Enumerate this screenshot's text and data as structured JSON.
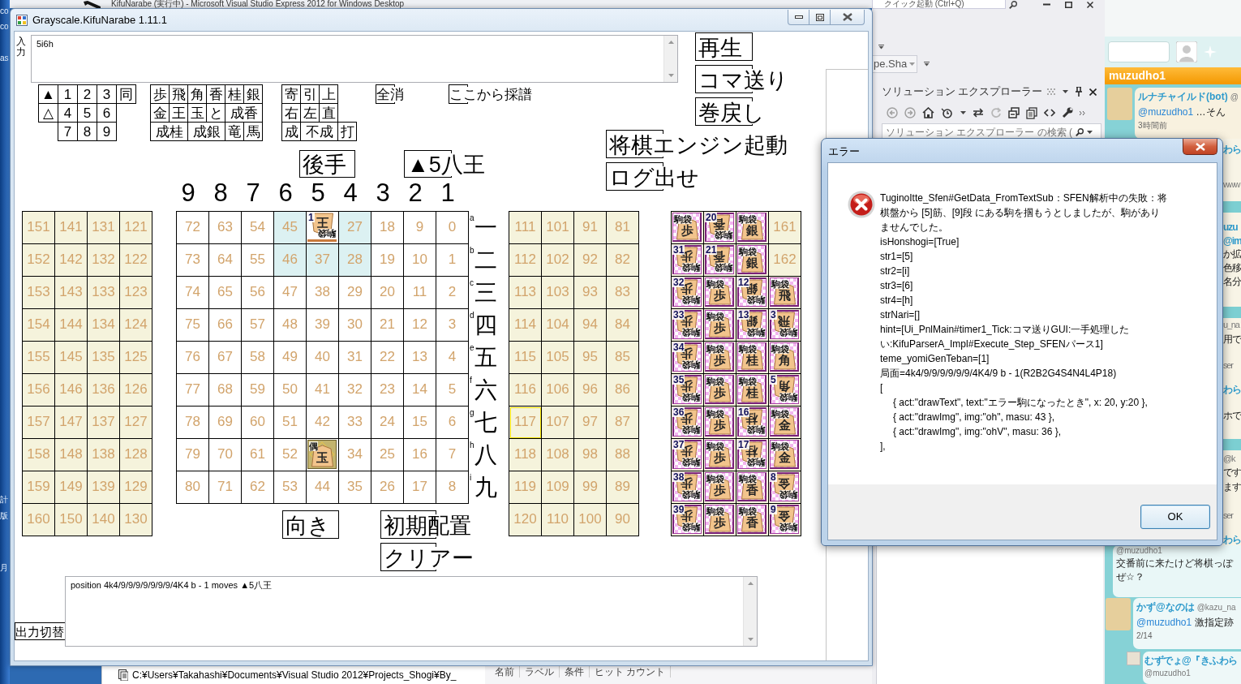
{
  "desktop": {
    "fragments": [
      "co",
      "co",
      "as",
      "計",
      "版",
      "月"
    ]
  },
  "ide": {
    "title": "KifuNarabe (実行中) - Microsoft Visual Studio Express 2012 for Windows Desktop",
    "quick_launch": {
      "placeholder": "クイック起動 (Ctrl+Q)"
    },
    "configuration": "pe.Sha",
    "solution_explorer": {
      "title": "ソリューション エクスプローラー",
      "search": {
        "placeholder": "ソリューション エクスプローラー の検索 ("
      }
    },
    "status_path": "C:¥Users¥Takahashi¥Documents¥Visual Studio 2012¥Projects_Shogi¥By_",
    "breakpoint_columns": [
      "名前",
      "ラベル",
      "条件",
      "ヒット カウント"
    ]
  },
  "app": {
    "title": "Grayscale.KifuNarabe 1.11.1",
    "input": {
      "label": "入力",
      "value": "5i6h"
    },
    "keypads": [
      [
        [
          "▲",
          "1",
          "2",
          "3",
          "同"
        ],
        [
          "△",
          "4",
          "5",
          "6"
        ],
        [
          "7",
          "8",
          "9"
        ]
      ],
      [
        [
          "歩",
          "飛",
          "角",
          "香",
          "桂",
          "銀"
        ],
        [
          "金",
          "王",
          "玉",
          "と",
          "成香"
        ],
        [
          "成桂",
          "成銀",
          "竜",
          "馬"
        ]
      ],
      [
        [
          "寄",
          "引",
          "上"
        ],
        [
          "右",
          "左",
          "直"
        ],
        [
          "成",
          "不成",
          "打"
        ]
      ]
    ],
    "buttons": [
      "全消",
      "ここから採譜",
      "再生",
      "コマ送り",
      "巻戻し",
      "将棋エンジン起動",
      "ログ出せ",
      "後手",
      "▲5八王",
      "向き",
      "初期配置",
      "クリアー",
      "出力切替"
    ],
    "file_labels": [
      "9",
      "8",
      "7",
      "6",
      "5",
      "4",
      "3",
      "2",
      "1"
    ],
    "rank_labels": [
      {
        "letter": "a",
        "kanji": "一"
      },
      {
        "letter": "b",
        "kanji": "二"
      },
      {
        "letter": "c",
        "kanji": "三"
      },
      {
        "letter": "d",
        "kanji": "四"
      },
      {
        "letter": "e",
        "kanji": "五"
      },
      {
        "letter": "f",
        "kanji": "六"
      },
      {
        "letter": "g",
        "kanji": "七"
      },
      {
        "letter": "h",
        "kanji": "八"
      },
      {
        "letter": "i",
        "kanji": "九"
      }
    ],
    "left_stand": [
      [
        "151",
        "141",
        "131",
        "121"
      ],
      [
        "152",
        "142",
        "132",
        "122"
      ],
      [
        "153",
        "143",
        "133",
        "123"
      ],
      [
        "154",
        "144",
        "134",
        "124"
      ],
      [
        "155",
        "145",
        "135",
        "125"
      ],
      [
        "156",
        "146",
        "136",
        "126"
      ],
      [
        "157",
        "147",
        "137",
        "127"
      ],
      [
        "158",
        "148",
        "138",
        "128"
      ],
      [
        "159",
        "149",
        "139",
        "129"
      ],
      [
        "160",
        "150",
        "140",
        "130"
      ]
    ],
    "board": [
      [
        {
          "number": "72",
          "highlighted": false
        },
        {
          "number": "63",
          "highlighted": false
        },
        {
          "number": "54",
          "highlighted": false
        },
        {
          "number": "45",
          "highlighted": true
        },
        {
          "piece": {
            "char": "王",
            "rotated": true,
            "number": "1",
            "tag": "駒袋",
            "last_move": false
          },
          "highlighted": false
        },
        {
          "number": "27",
          "highlighted": true
        },
        {
          "number": "18",
          "highlighted": false
        },
        {
          "number": "9",
          "highlighted": false
        },
        {
          "number": "0",
          "highlighted": false
        }
      ],
      [
        {
          "number": "73",
          "highlighted": false
        },
        {
          "number": "64",
          "highlighted": false
        },
        {
          "number": "55",
          "highlighted": false
        },
        {
          "number": "46",
          "highlighted": true
        },
        {
          "number": "37",
          "highlighted": true
        },
        {
          "number": "28",
          "highlighted": true
        },
        {
          "number": "19",
          "highlighted": false
        },
        {
          "number": "10",
          "highlighted": false
        },
        {
          "number": "1",
          "highlighted": false
        }
      ],
      [
        {
          "number": "74",
          "highlighted": false
        },
        {
          "number": "65",
          "highlighted": false
        },
        {
          "number": "56",
          "highlighted": false
        },
        {
          "number": "47",
          "highlighted": false
        },
        {
          "number": "38",
          "highlighted": false
        },
        {
          "number": "29",
          "highlighted": false
        },
        {
          "number": "20",
          "highlighted": false
        },
        {
          "number": "11",
          "highlighted": false
        },
        {
          "number": "2",
          "highlighted": false
        }
      ],
      [
        {
          "number": "75",
          "highlighted": false
        },
        {
          "number": "66",
          "highlighted": false
        },
        {
          "number": "57",
          "highlighted": false
        },
        {
          "number": "48",
          "highlighted": false
        },
        {
          "number": "39",
          "highlighted": false
        },
        {
          "number": "30",
          "highlighted": false
        },
        {
          "number": "21",
          "highlighted": false
        },
        {
          "number": "12",
          "highlighted": false
        },
        {
          "number": "3",
          "highlighted": false
        }
      ],
      [
        {
          "number": "76",
          "highlighted": false
        },
        {
          "number": "67",
          "highlighted": false
        },
        {
          "number": "58",
          "highlighted": false
        },
        {
          "number": "49",
          "highlighted": false
        },
        {
          "number": "40",
          "highlighted": false
        },
        {
          "number": "31",
          "highlighted": false
        },
        {
          "number": "22",
          "highlighted": false
        },
        {
          "number": "13",
          "highlighted": false
        },
        {
          "number": "4",
          "highlighted": false
        }
      ],
      [
        {
          "number": "77",
          "highlighted": false
        },
        {
          "number": "68",
          "highlighted": false
        },
        {
          "number": "59",
          "highlighted": false
        },
        {
          "number": "50",
          "highlighted": false
        },
        {
          "number": "41",
          "highlighted": false
        },
        {
          "number": "32",
          "highlighted": false
        },
        {
          "number": "23",
          "highlighted": false
        },
        {
          "number": "14",
          "highlighted": false
        },
        {
          "number": "5",
          "highlighted": false
        }
      ],
      [
        {
          "number": "78",
          "highlighted": false
        },
        {
          "number": "69",
          "highlighted": false
        },
        {
          "number": "60",
          "highlighted": false
        },
        {
          "number": "51",
          "highlighted": false
        },
        {
          "number": "42",
          "highlighted": false
        },
        {
          "number": "33",
          "highlighted": false
        },
        {
          "number": "24",
          "highlighted": false
        },
        {
          "number": "15",
          "highlighted": false
        },
        {
          "number": "6",
          "highlighted": false
        }
      ],
      [
        {
          "number": "79",
          "highlighted": false
        },
        {
          "number": "70",
          "highlighted": false
        },
        {
          "number": "61",
          "highlighted": false
        },
        {
          "number": "52",
          "highlighted": false
        },
        {
          "piece": {
            "char": "玉",
            "rotated": false,
            "tag": "偶",
            "last_move": true
          },
          "highlighted": false
        },
        {
          "number": "34",
          "highlighted": false
        },
        {
          "number": "25",
          "highlighted": false
        },
        {
          "number": "16",
          "highlighted": false
        },
        {
          "number": "7",
          "highlighted": false
        }
      ],
      [
        {
          "number": "80",
          "highlighted": false
        },
        {
          "number": "71",
          "highlighted": false
        },
        {
          "number": "62",
          "highlighted": false
        },
        {
          "number": "53",
          "highlighted": false
        },
        {
          "number": "44",
          "highlighted": false
        },
        {
          "number": "35",
          "highlighted": false
        },
        {
          "number": "26",
          "highlighted": false
        },
        {
          "number": "17",
          "highlighted": false
        },
        {
          "number": "8",
          "highlighted": false
        }
      ]
    ],
    "right_stand": [
      [
        {
          "number": "111",
          "focused": false
        },
        {
          "number": "101",
          "focused": false
        },
        {
          "number": "91",
          "focused": false
        },
        {
          "number": "81",
          "focused": false
        }
      ],
      [
        {
          "number": "112",
          "focused": false
        },
        {
          "number": "102",
          "focused": false
        },
        {
          "number": "92",
          "focused": false
        },
        {
          "number": "82",
          "focused": false
        }
      ],
      [
        {
          "number": "113",
          "focused": false
        },
        {
          "number": "103",
          "focused": false
        },
        {
          "number": "93",
          "focused": false
        },
        {
          "number": "83",
          "focused": false
        }
      ],
      [
        {
          "number": "114",
          "focused": false
        },
        {
          "number": "104",
          "focused": false
        },
        {
          "number": "94",
          "focused": false
        },
        {
          "number": "84",
          "focused": false
        }
      ],
      [
        {
          "number": "115",
          "focused": false
        },
        {
          "number": "105",
          "focused": false
        },
        {
          "number": "95",
          "focused": false
        },
        {
          "number": "85",
          "focused": false
        }
      ],
      [
        {
          "number": "116",
          "focused": false
        },
        {
          "number": "106",
          "focused": false
        },
        {
          "number": "96",
          "focused": false
        },
        {
          "number": "86",
          "focused": false
        }
      ],
      [
        {
          "number": "117",
          "focused": true
        },
        {
          "number": "107",
          "focused": false
        },
        {
          "number": "97",
          "focused": false
        },
        {
          "number": "87",
          "focused": false
        }
      ],
      [
        {
          "number": "118",
          "focused": false
        },
        {
          "number": "108",
          "focused": false
        },
        {
          "number": "98",
          "focused": false
        },
        {
          "number": "88",
          "focused": false
        }
      ],
      [
        {
          "number": "119",
          "focused": false
        },
        {
          "number": "109",
          "focused": false
        },
        {
          "number": "99",
          "focused": false
        },
        {
          "number": "89",
          "focused": false
        }
      ],
      [
        {
          "number": "120",
          "focused": false
        },
        {
          "number": "110",
          "focused": false
        },
        {
          "number": "100",
          "focused": false
        },
        {
          "number": "90",
          "focused": false
        }
      ]
    ],
    "piece_bag": [
      [
        {
          "kind": "piece",
          "tag": "駒袋",
          "char": "歩",
          "rotated": false
        },
        {
          "kind": "piece",
          "number": "20",
          "tag": "駒袋",
          "char": "香",
          "rotated": true
        },
        {
          "kind": "piece",
          "tag": "駒袋",
          "char": "銀",
          "rotated": false
        },
        {
          "kind": "empty",
          "number": "161"
        }
      ],
      [
        {
          "kind": "piece",
          "number": "31",
          "tag": "駒袋",
          "char": "歩",
          "rotated": true
        },
        {
          "kind": "piece",
          "number": "21",
          "tag": "駒袋",
          "char": "香",
          "rotated": true
        },
        {
          "kind": "piece",
          "tag": "駒袋",
          "char": "銀",
          "rotated": false
        },
        {
          "kind": "empty",
          "number": "162"
        }
      ],
      [
        {
          "kind": "piece",
          "number": "32",
          "tag": "駒袋",
          "char": "歩",
          "rotated": true
        },
        {
          "kind": "piece",
          "tag": "駒袋",
          "char": "歩",
          "rotated": false
        },
        {
          "kind": "piece",
          "number": "12",
          "tag": "駒袋",
          "char": "銀",
          "rotated": true
        },
        {
          "kind": "piece",
          "tag": "駒袋",
          "char": "飛",
          "rotated": false
        }
      ],
      [
        {
          "kind": "piece",
          "number": "33",
          "tag": "駒袋",
          "char": "歩",
          "rotated": true
        },
        {
          "kind": "piece",
          "tag": "駒袋",
          "char": "歩",
          "rotated": false
        },
        {
          "kind": "piece",
          "number": "13",
          "tag": "駒袋",
          "char": "銀",
          "rotated": true
        },
        {
          "kind": "piece",
          "number": "3",
          "tag": "駒袋",
          "char": "飛",
          "rotated": true
        }
      ],
      [
        {
          "kind": "piece",
          "number": "34",
          "tag": "駒袋",
          "char": "歩",
          "rotated": true
        },
        {
          "kind": "piece",
          "tag": "駒袋",
          "char": "歩",
          "rotated": false
        },
        {
          "kind": "piece",
          "tag": "駒袋",
          "char": "桂",
          "rotated": false
        },
        {
          "kind": "piece",
          "tag": "駒袋",
          "char": "角",
          "rotated": false
        }
      ],
      [
        {
          "kind": "piece",
          "number": "35",
          "tag": "駒袋",
          "char": "歩",
          "rotated": true
        },
        {
          "kind": "piece",
          "tag": "駒袋",
          "char": "歩",
          "rotated": false
        },
        {
          "kind": "piece",
          "tag": "駒袋",
          "char": "桂",
          "rotated": false
        },
        {
          "kind": "piece",
          "number": "5",
          "tag": "駒袋",
          "char": "角",
          "rotated": true
        }
      ],
      [
        {
          "kind": "piece",
          "number": "36",
          "tag": "駒袋",
          "char": "歩",
          "rotated": true
        },
        {
          "kind": "piece",
          "tag": "駒袋",
          "char": "歩",
          "rotated": false
        },
        {
          "kind": "piece",
          "number": "16",
          "tag": "駒袋",
          "char": "桂",
          "rotated": true
        },
        {
          "kind": "piece",
          "tag": "駒袋",
          "char": "金",
          "rotated": false
        }
      ],
      [
        {
          "kind": "piece",
          "number": "37",
          "tag": "駒袋",
          "char": "歩",
          "rotated": true
        },
        {
          "kind": "piece",
          "tag": "駒袋",
          "char": "歩",
          "rotated": false
        },
        {
          "kind": "piece",
          "number": "17",
          "tag": "駒袋",
          "char": "桂",
          "rotated": true
        },
        {
          "kind": "piece",
          "tag": "駒袋",
          "char": "金",
          "rotated": false
        }
      ],
      [
        {
          "kind": "piece",
          "number": "38",
          "tag": "駒袋",
          "char": "歩",
          "rotated": true
        },
        {
          "kind": "piece",
          "tag": "駒袋",
          "char": "歩",
          "rotated": false
        },
        {
          "kind": "piece",
          "tag": "駒袋",
          "char": "香",
          "rotated": false
        },
        {
          "kind": "piece",
          "number": "8",
          "tag": "駒袋",
          "char": "金",
          "rotated": true
        }
      ],
      [
        {
          "kind": "piece",
          "number": "39",
          "tag": "駒袋",
          "char": "歩",
          "rotated": true
        },
        {
          "kind": "piece",
          "tag": "駒袋",
          "char": "歩",
          "rotated": false
        },
        {
          "kind": "piece",
          "tag": "駒袋",
          "char": "香",
          "rotated": false
        },
        {
          "kind": "piece",
          "number": "9",
          "tag": "駒袋",
          "char": "金",
          "rotated": true
        }
      ]
    ],
    "output": {
      "value": "position 4k4/9/9/9/9/9/9/9/4K4 b - 1 moves ▲5八王"
    }
  },
  "dialog": {
    "title": "エラー",
    "message": [
      {
        "kind": "text",
        "text": "TuginoItte_Sfen#GetData_FromTextSub：SFEN解析中の失敗：将棋盤から [5]筋、[9]段 にある駒を掴もうとしましたが、駒がありませんでした。"
      },
      {
        "kind": "text",
        "text": "isHonshogi=[True]"
      },
      {
        "kind": "text",
        "text": "str1=[5]"
      },
      {
        "kind": "text",
        "text": "str2=[i]"
      },
      {
        "kind": "text",
        "text": "str3=[6]"
      },
      {
        "kind": "text",
        "text": "str4=[h]"
      },
      {
        "kind": "text",
        "text": "strNari=[]"
      },
      {
        "kind": "text",
        "text": "hint=[Ui_PnlMain#timer1_Tick:コマ送りGUI:一手処理したい:KifuParserA_Impl#Execute_Step_SFENパース1]"
      },
      {
        "kind": "text",
        "text": "teme_yomiGenTeban=[1]"
      },
      {
        "kind": "text",
        "text": "局面=4k4/9/9/9/9/9/9/4K4/9 b - 1(R2B2G4S4N4L4P18)"
      },
      {
        "kind": "text",
        "text": "["
      },
      {
        "kind": "code",
        "text": "{ act:\"drawText\", text:\"エラー駒になったとき\", x: 20, y:20 },"
      },
      {
        "kind": "code",
        "text": "{ act:\"drawImg\", img:\"oh\", masu: 43 },"
      },
      {
        "kind": "code",
        "text": "{ act:\"drawImg\", img:\"ohV\", masu: 36 },"
      },
      {
        "kind": "text",
        "text": "],"
      }
    ],
    "ok_button": "OK"
  },
  "timeline": {
    "header": "muzudho1",
    "tweets": [
      {
        "kind": "full",
        "author": "ルナチャイルド(bot)",
        "handle": "@",
        "mention": "@muzudho1",
        "text": "…そん",
        "time": "3時間前"
      },
      {
        "kind": "continued",
        "handle": "@muzudho1",
        "lines": [
          "交番前に来たけど将棋っぽ",
          "ぜ☆？"
        ]
      },
      {
        "kind": "full",
        "author": "かず@なのは",
        "handle": "@kazu_na",
        "mention": "@muzudho1",
        "text": "激指定跡",
        "time": "2/14"
      },
      {
        "kind": "partial",
        "author": "むずでょ@『きふわら",
        "handle": "@muzudho1"
      }
    ],
    "edge_fragments": [
      {
        "kind": "author",
        "text": "わら"
      },
      {
        "kind": "handle",
        "text": "www"
      },
      {
        "kind": "author",
        "text": "uzu"
      },
      {
        "kind": "author",
        "text": "@im"
      },
      {
        "kind": "text",
        "text": "か拡"
      },
      {
        "kind": "text",
        "text": "色移"
      },
      {
        "kind": "text",
        "text": "名分"
      },
      {
        "kind": "handle",
        "text": "u_na"
      },
      {
        "kind": "text",
        "text": "用で"
      },
      {
        "kind": "handle",
        "text": "ser"
      },
      {
        "kind": "author",
        "text": "わら"
      },
      {
        "kind": "text",
        "text": "ホで"
      },
      {
        "kind": "handle",
        "text": "@k"
      },
      {
        "kind": "text",
        "text": "です"
      },
      {
        "kind": "text",
        "text": "ます"
      },
      {
        "kind": "handle",
        "text": "ser"
      },
      {
        "kind": "author",
        "text": "わら"
      }
    ]
  }
}
